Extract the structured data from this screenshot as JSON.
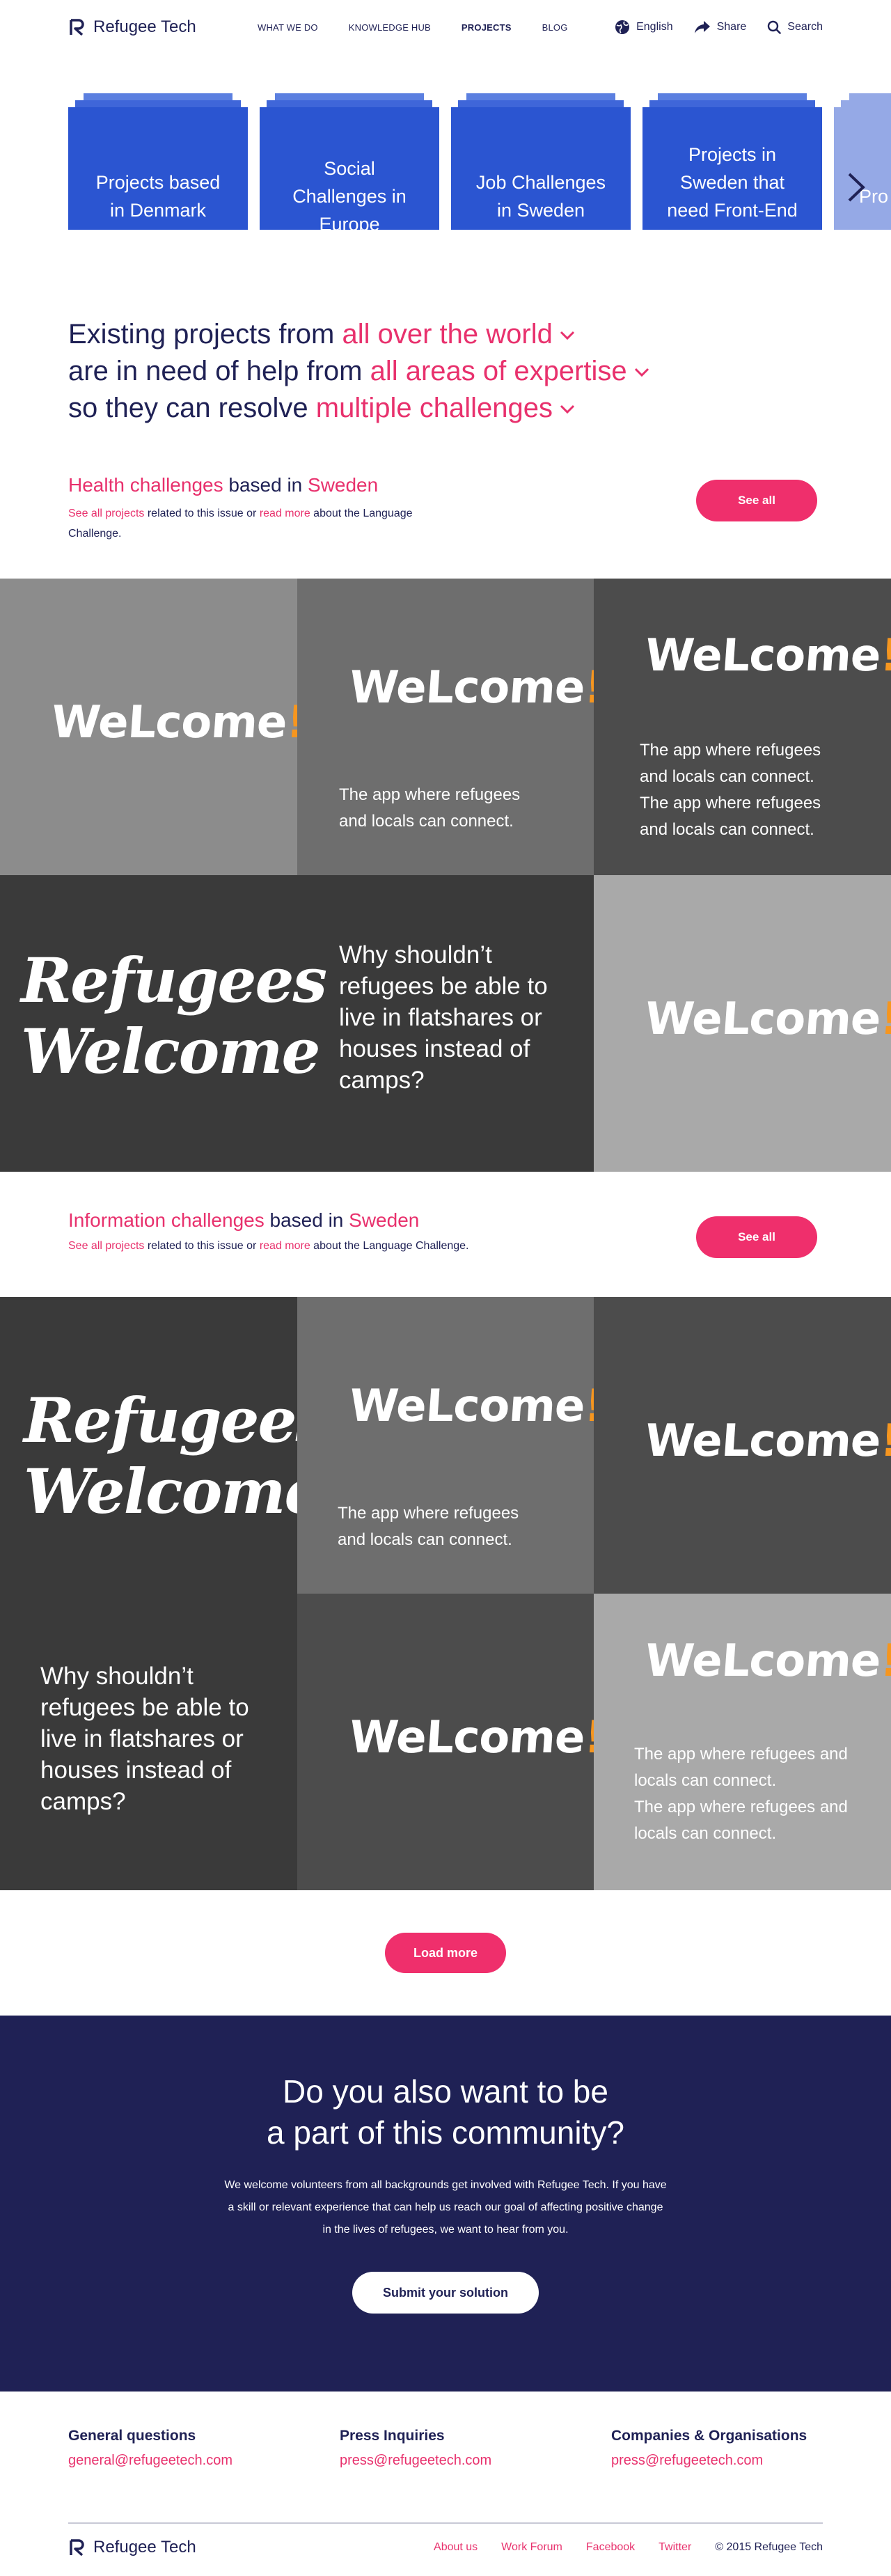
{
  "header": {
    "logo_text": "Refugee Tech",
    "nav": [
      "WHAT WE DO",
      "KNOWLEDGE HUB",
      "PROJECTS",
      "BLOG"
    ],
    "language": "English",
    "share": "Share",
    "search": "Search"
  },
  "carousel": {
    "cards": [
      "Projects based in Denmark",
      "Social Challenges in Europe",
      "Job Challenges in Sweden",
      "Projects in Sweden that need Front-End Developer",
      "Pro in"
    ]
  },
  "intro": {
    "l1_a": "Existing projects from ",
    "l1_b": "all over the world",
    "l2_a": "are in need of help from ",
    "l2_b": "all areas of expertise",
    "l3_a": "so they can resolve ",
    "l3_b": "multiple challenges"
  },
  "section1": {
    "topic": "Health challenges",
    "based_in": " based in ",
    "place": "Sweden",
    "link_all": "See all projects",
    "mid": " related to this issue or ",
    "link_more": "read more",
    "tail": " about the Language Challenge.",
    "button": "See all"
  },
  "section2": {
    "topic": "Information challenges",
    "based_in": " based in ",
    "place": "Sweden",
    "link_all": "See all projects",
    "mid": " related to this issue or ",
    "link_more": "read more",
    "tail": " about the Language Challenge.",
    "button": "See all"
  },
  "tiles": {
    "welcome": "WeLcome",
    "bang": "!",
    "tagline": "The app where refugees and locals can connect.",
    "rw1": "Refugees",
    "rw2": "Welcome",
    "question": "Why shouldn’t refugees be able to live in flatshares or houses instead of camps?"
  },
  "load_more": "Load more",
  "community": {
    "title_1": "Do you also want to be",
    "title_2": "a part of this community?",
    "text": "We welcome volunteers from all backgrounds get involved with Refugee Tech. If you have a skill or relevant experience that can help us reach our goal of affecting positive change in the lives of refugees, we want to hear from you.",
    "button": "Submit your solution"
  },
  "footer": {
    "contacts": [
      {
        "title": "General questions",
        "email": "general@refugeetech.com"
      },
      {
        "title": "Press Inquiries",
        "email": "press@refugeetech.com"
      },
      {
        "title": "Companies & Organisations",
        "email": "press@refugeetech.com"
      }
    ],
    "logo_text": "Refugee Tech",
    "links": [
      "About us",
      "Work Forum",
      "Facebook",
      "Twitter"
    ],
    "copyright": "© 2015 Refugee Tech"
  },
  "colors": {
    "navy": "#1f2155",
    "pink": "#e8316d",
    "blue": "#2b55d1",
    "orange": "#f6961f"
  }
}
